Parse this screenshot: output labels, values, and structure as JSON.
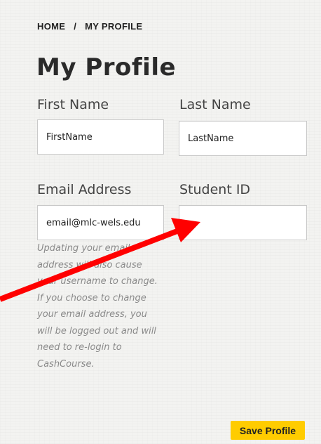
{
  "breadcrumb": {
    "home": "HOME",
    "separator": "/",
    "current": "MY PROFILE"
  },
  "page_title": "My Profile",
  "form": {
    "first_name": {
      "label": "First Name",
      "value": "FirstName"
    },
    "last_name": {
      "label": "Last Name",
      "value": "LastName"
    },
    "email": {
      "label": "Email Address",
      "value": "email@mlc-wels.edu"
    },
    "student_id": {
      "label": "Student ID",
      "value": ""
    },
    "email_help": "Updating your email\naddress will also cause\nyour username to change.\nIf you choose to change\nyour email address, you\nwill be logged out and will\nneed to re-login to\nCashCourse."
  },
  "save_button": {
    "label": "Save Profile"
  },
  "colors": {
    "accent": "#ffcc00",
    "annotation_arrow": "#ff0000"
  }
}
